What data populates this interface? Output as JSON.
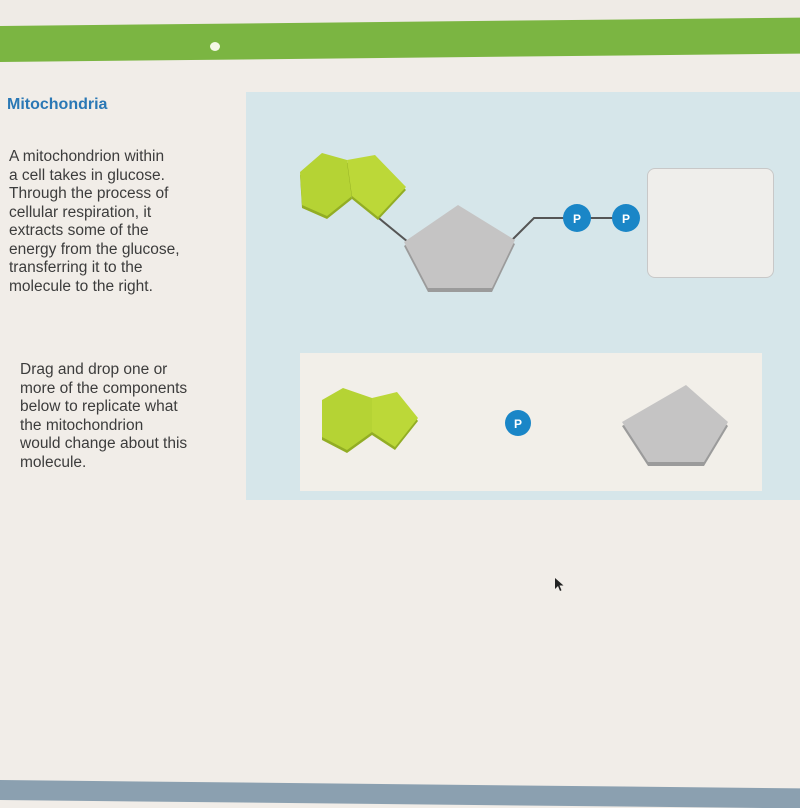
{
  "header": {
    "accent_color": "#7bb542"
  },
  "lesson": {
    "title": "Mitochondria",
    "intro_lines": [
      "A mitochondrion within",
      "a cell takes in glucose.",
      "Through the process of",
      "cellular respiration, it",
      "extracts some of the",
      "energy from the glucose,",
      "transferring it to the",
      "molecule to the right."
    ],
    "instruction_lines": [
      "Drag and drop one or",
      "more of the components",
      "below to replicate what",
      "the mitochondrion",
      "would change about this",
      "molecule."
    ]
  },
  "molecule": {
    "components": [
      "adenine",
      "ribose",
      "phosphate",
      "phosphate"
    ],
    "phosphate_label": "P",
    "drop_target": "empty"
  },
  "tray": {
    "items": [
      {
        "name": "adenine",
        "label": ""
      },
      {
        "name": "phosphate",
        "label": "P"
      },
      {
        "name": "ribose",
        "label": ""
      }
    ]
  },
  "colors": {
    "title": "#2a78b5",
    "adenine": "#b5d334",
    "ribose": "#c5c4c4",
    "phosphate": "#1a86c7",
    "panel": "#d6e6ea"
  }
}
